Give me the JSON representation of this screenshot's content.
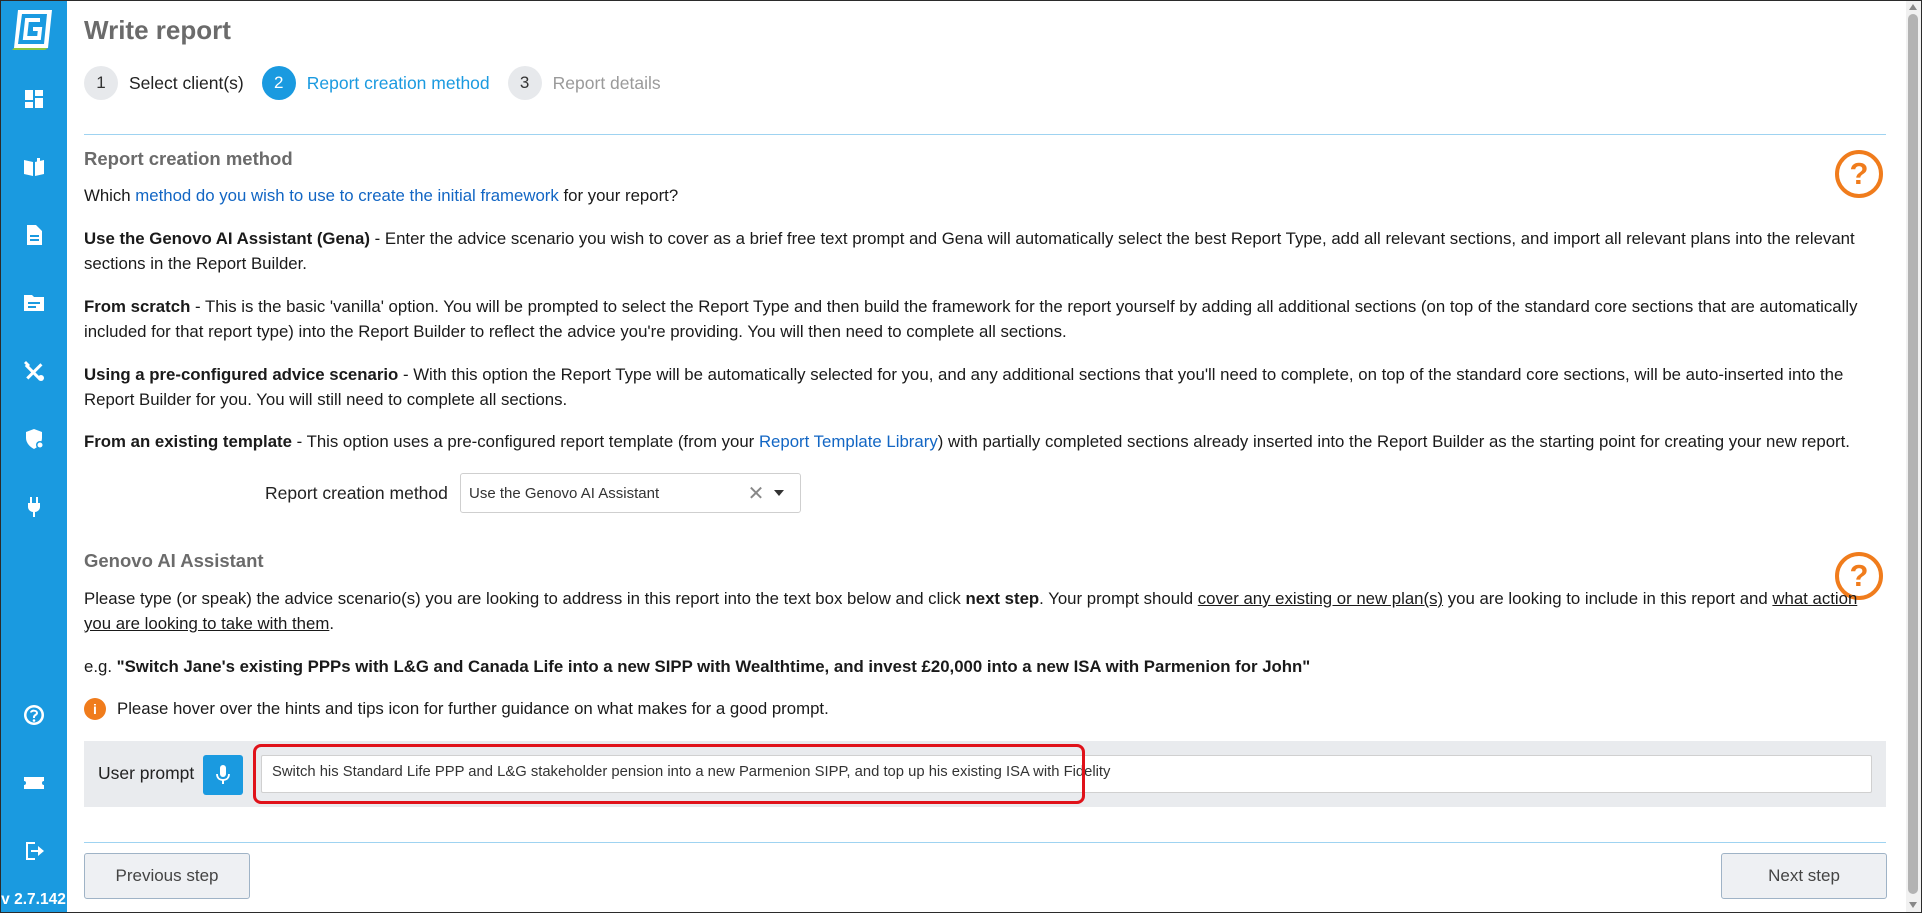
{
  "app": {
    "version": "v 2.7.142",
    "accent_color": "#1a9ae0",
    "help_color": "#f07c1c"
  },
  "sidebar": {
    "items": [
      {
        "name": "dashboard-icon"
      },
      {
        "name": "library-book-icon"
      },
      {
        "name": "document-icon"
      },
      {
        "name": "folder-icon"
      },
      {
        "name": "tools-icon"
      },
      {
        "name": "shield-icon"
      },
      {
        "name": "plug-icon"
      },
      {
        "name": "help-circle-icon"
      },
      {
        "name": "ticket-icon"
      },
      {
        "name": "logout-icon"
      }
    ]
  },
  "header": {
    "title": "Write report"
  },
  "steps": [
    {
      "num": "1",
      "label": "Select client(s)",
      "state": "done"
    },
    {
      "num": "2",
      "label": "Report creation method",
      "state": "active"
    },
    {
      "num": "3",
      "label": "Report details",
      "state": "disabled"
    }
  ],
  "creation": {
    "title": "Report creation method",
    "help_glyph": "?",
    "intro_before": "Which ",
    "intro_link": "method do you wish to use to create the initial framework",
    "intro_after": " for your report?",
    "options": [
      {
        "bold": "Use the Genovo AI Assistant (Gena)",
        "text": " - Enter the advice scenario you wish to cover as a brief free text prompt and Gena will automatically select the best Report Type, add all relevant sections, and import all relevant plans into the relevant sections in the Report Builder."
      },
      {
        "bold": "From scratch",
        "text": " - This is the basic 'vanilla' option. You will be prompted to select the Report Type and then build the framework for the report yourself by adding all additional sections (on top of the standard core sections that are automatically included for that report type) into the Report Builder to reflect the advice you're providing. You will then need to complete all sections."
      },
      {
        "bold": "Using a pre-configured advice scenario",
        "text": " - With this option the Report Type will be automatically selected for you, and any additional sections that you'll need to complete, on top of the standard core sections, will be auto-inserted into the Report Builder for you. You will still need to complete all sections."
      }
    ],
    "template_bold": "From an existing template",
    "template_before": " - This option uses a pre-configured report template (from your ",
    "template_link": "Report Template Library",
    "template_after": ") with partially completed sections already inserted into the Report Builder as the starting point for creating your new report.",
    "field_label": "Report creation method",
    "selected_value": "Use the Genovo AI Assistant",
    "clear_glyph": "✕"
  },
  "assistant": {
    "title": "Genovo AI Assistant",
    "help_glyph": "?",
    "p1_before": "Please type (or speak) the advice scenario(s) you are looking to address in this report into the text box below and click ",
    "p1_bold": "next step",
    "p1_mid": ". Your prompt should ",
    "p1_u1": "cover any existing or new plan(s)",
    "p1_mid2": " you are looking to include in this report and ",
    "p1_u2": "what action you are looking to take with them",
    "p1_end": ".",
    "example_prefix": "e.g. ",
    "example_text": "\"Switch Jane's existing PPPs with L&G and Canada Life into a new SIPP with Wealthtime, and invest £20,000 into a new ISA with Parmenion for John\"",
    "info_glyph": "i",
    "hint": "Please hover over the hints and tips icon for further guidance on what makes for a good prompt.",
    "prompt_label": "User prompt",
    "prompt_value": "Switch his Standard Life PPP and L&G stakeholder pension into a new Parmenion SIPP, and top up his existing ISA with Fidelity"
  },
  "footer": {
    "prev_label": "Previous step",
    "next_label": "Next step"
  }
}
